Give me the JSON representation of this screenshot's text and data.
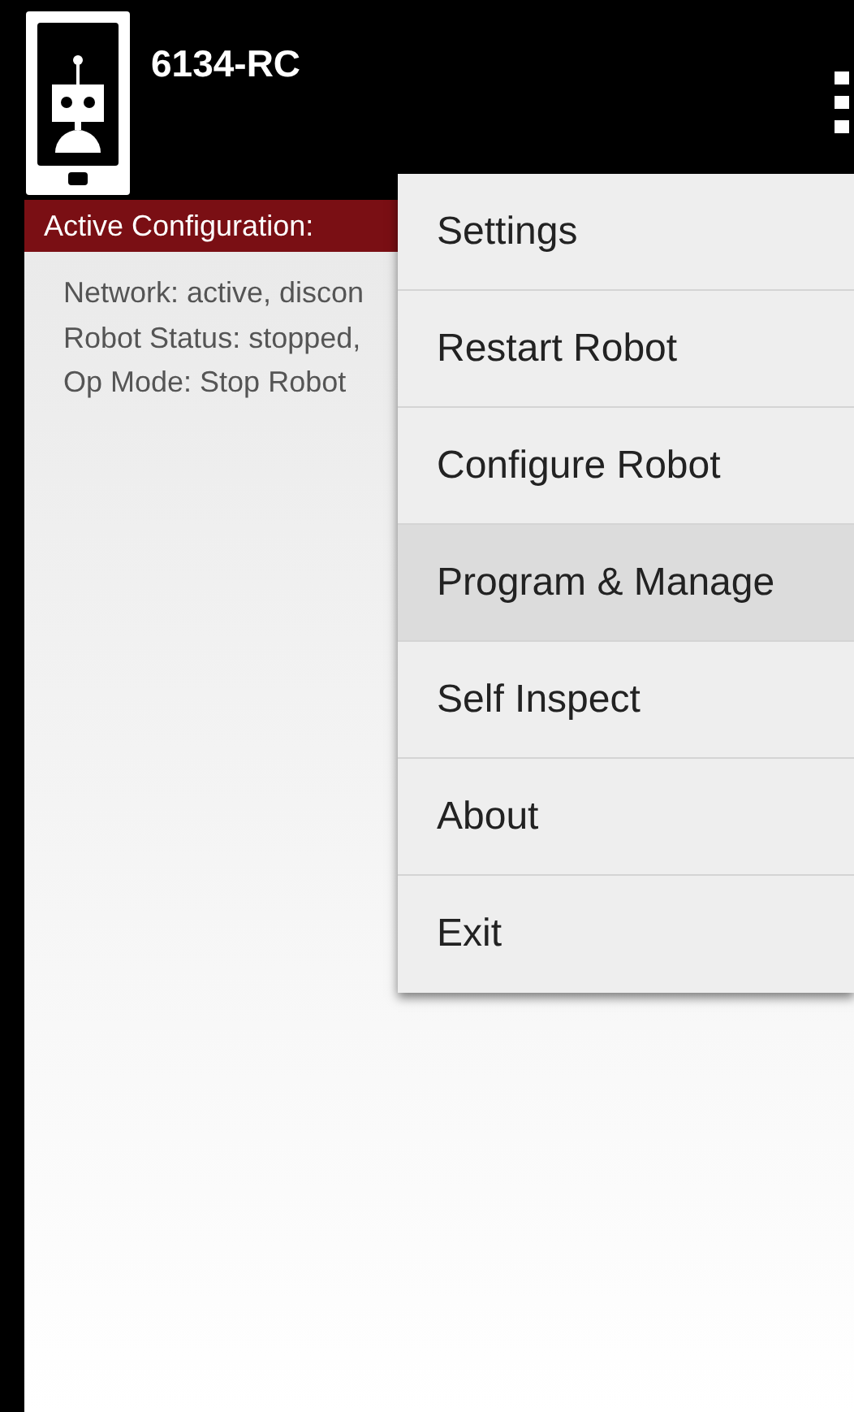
{
  "app_bar": {
    "title": "6134-RC"
  },
  "header": {
    "label": "Active Configuration:"
  },
  "status_lines": [
    "Network: active, discon",
    "Robot Status: stopped,",
    "Op Mode: Stop Robot"
  ],
  "menu": [
    {
      "label": "Settings",
      "selected": false
    },
    {
      "label": "Restart Robot",
      "selected": false
    },
    {
      "label": "Configure Robot",
      "selected": false
    },
    {
      "label": "Program & Manage",
      "selected": true
    },
    {
      "label": "Self Inspect",
      "selected": false
    },
    {
      "label": "About",
      "selected": false
    },
    {
      "label": "Exit",
      "selected": false
    }
  ]
}
